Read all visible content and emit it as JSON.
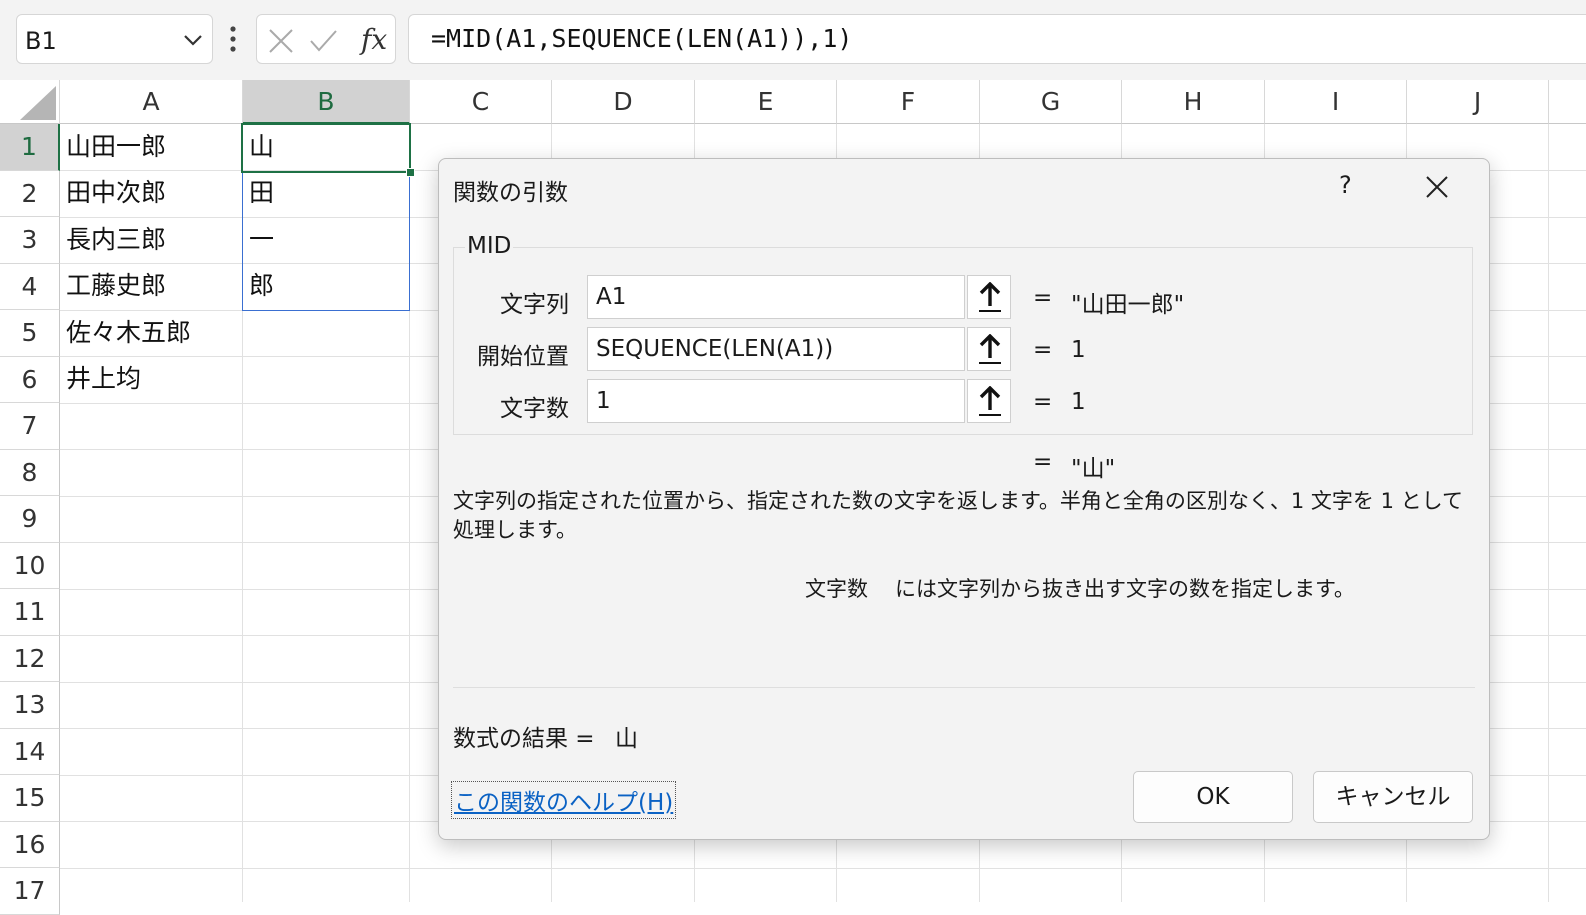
{
  "formula_bar": {
    "name_box": "B1",
    "cancel_icon": "x-icon",
    "enter_icon": "check-icon",
    "fx_label": "fx",
    "formula": "=MID(A1,SEQUENCE(LEN(A1)),1)"
  },
  "grid": {
    "columns": [
      "A",
      "B",
      "C",
      "D",
      "E",
      "F",
      "G",
      "H",
      "I",
      "J"
    ],
    "rows": [
      "1",
      "2",
      "3",
      "4",
      "5",
      "6",
      "7",
      "8",
      "9",
      "10",
      "11",
      "12",
      "13",
      "14",
      "15",
      "16",
      "17"
    ],
    "col_a": [
      "山田一郎",
      "田中次郎",
      "長内三郎",
      "工藤史郎",
      "佐々木五郎",
      "井上均"
    ],
    "col_b": [
      "山",
      "田",
      "一",
      "郎"
    ]
  },
  "dialog": {
    "title": "関数の引数",
    "help_symbol": "?",
    "function_name": "MID",
    "args": [
      {
        "label": "文字列",
        "value": "A1",
        "eq": "=",
        "result": "\"山田一郎\""
      },
      {
        "label": "開始位置",
        "value": "SEQUENCE(LEN(A1))",
        "eq": "=",
        "result": "1"
      },
      {
        "label": "文字数",
        "value": "1",
        "eq": "=",
        "result": "1"
      }
    ],
    "overall_eq": "=",
    "overall_result": "\"山\"",
    "description": "文字列の指定された位置から、指定された数の文字を返します。半角と全角の区別なく、1 文字を 1 として処理します。",
    "arg_desc_name": "文字数",
    "arg_desc_text": "には文字列から抜き出す文字の数を指定します。",
    "result_label": "数式の結果 =",
    "result_value": "山",
    "help_link": "この関数のヘルプ(H)",
    "ok_label": "OK",
    "cancel_label": "キャンセル"
  }
}
